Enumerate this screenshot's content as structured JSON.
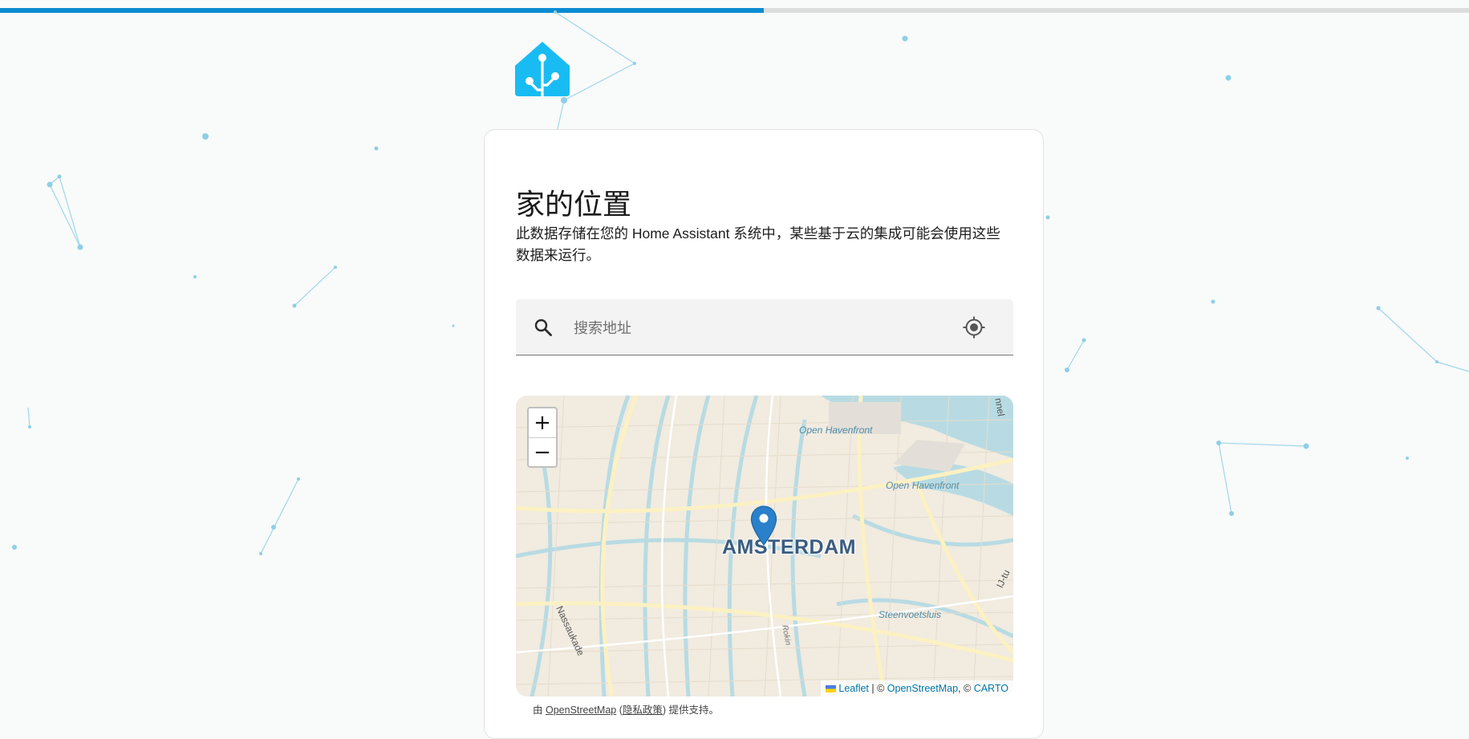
{
  "progress": {
    "value": 0.52,
    "color": "#0b8bd3",
    "track_color": "#dcdcdc"
  },
  "logo": {
    "icon": "home-assistant-logo",
    "color": "#18bcf2"
  },
  "page": {
    "title": "家的位置",
    "description": "此数据存储在您的 Home Assistant 系统中，某些基于云的集成可能会使用这些数据来运行。"
  },
  "search": {
    "placeholder": "搜索地址",
    "value": "",
    "icon": "search-icon",
    "locate_icon": "my-location-icon"
  },
  "map": {
    "zoom_in": "+",
    "zoom_out": "−",
    "city": "AMSTERDAM",
    "labels": {
      "open_havenfront_1": "Open Havenfront",
      "open_havenfront_2": "Open Havenfront",
      "steenvoetsluis": "Steenvoetsluis",
      "nassaukade": "Nassaukade",
      "ij_tunnel": "IJ-tu",
      "tunnel": "nnel",
      "rokin": "Rokin"
    },
    "attribution": {
      "leaflet": "Leaflet",
      "sep": " | © ",
      "osm": "OpenStreetMap",
      "comma": ", © ",
      "carto": "CARTO"
    }
  },
  "osm_note": {
    "prefix": "由 ",
    "link": "OpenStreetMap",
    "open": " (",
    "privacy": "隐私政策",
    "suffix": ") 提供支持。"
  },
  "colors": {
    "accent": "#03a9f4",
    "marker": "#2a81cb",
    "water": "#b3d9e1",
    "land": "#f1ebe0"
  }
}
